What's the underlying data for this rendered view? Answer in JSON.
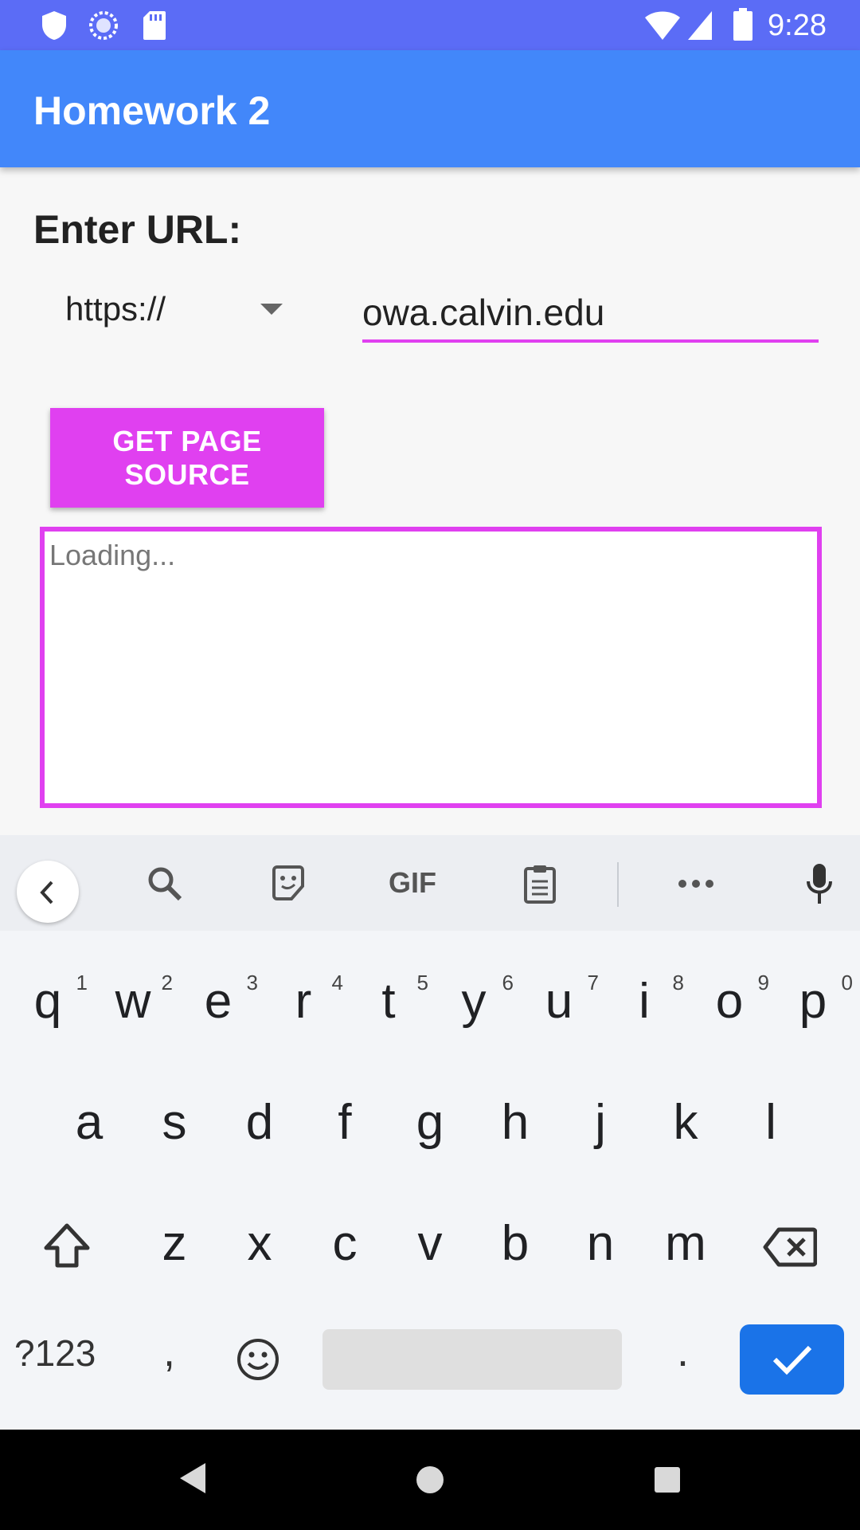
{
  "status_bar": {
    "time": "9:28",
    "left_icons": [
      "shield-icon",
      "sync-icon",
      "sd-card-icon"
    ],
    "right_icons": [
      "wifi-icon",
      "cell-signal-icon",
      "battery-icon"
    ],
    "background_color": "#5b6cf6"
  },
  "app_bar": {
    "title": "Homework 2",
    "background_color": "#4287fa"
  },
  "form": {
    "url_label": "Enter URL:",
    "scheme_selected": "https://",
    "host_value": "owa.calvin.edu",
    "button_label": "GET PAGE SOURCE",
    "accent_color": "#e040f0"
  },
  "output": {
    "text": "Loading..."
  },
  "keyboard": {
    "toolbar_icons": [
      "back-chevron-icon",
      "search-icon",
      "sticker-icon",
      "gif-icon",
      "clipboard-icon",
      "more-icon",
      "mic-icon"
    ],
    "gif_label": "GIF",
    "rows": [
      [
        {
          "label": "q",
          "hint": "1"
        },
        {
          "label": "w",
          "hint": "2"
        },
        {
          "label": "e",
          "hint": "3"
        },
        {
          "label": "r",
          "hint": "4"
        },
        {
          "label": "t",
          "hint": "5"
        },
        {
          "label": "y",
          "hint": "6"
        },
        {
          "label": "u",
          "hint": "7"
        },
        {
          "label": "i",
          "hint": "8"
        },
        {
          "label": "o",
          "hint": "9"
        },
        {
          "label": "p",
          "hint": "0"
        }
      ],
      [
        {
          "label": "a"
        },
        {
          "label": "s"
        },
        {
          "label": "d"
        },
        {
          "label": "f"
        },
        {
          "label": "g"
        },
        {
          "label": "h"
        },
        {
          "label": "j"
        },
        {
          "label": "k"
        },
        {
          "label": "l"
        }
      ],
      [
        {
          "label": "z"
        },
        {
          "label": "x"
        },
        {
          "label": "c"
        },
        {
          "label": "v"
        },
        {
          "label": "b"
        },
        {
          "label": "n"
        },
        {
          "label": "m"
        }
      ]
    ],
    "symbols_label": "?123",
    "comma_label": ",",
    "period_label": ".",
    "enter_color": "#1a73e8"
  },
  "nav_bar": {
    "icons": [
      "back-triangle-icon",
      "home-circle-icon",
      "recents-square-icon"
    ]
  }
}
